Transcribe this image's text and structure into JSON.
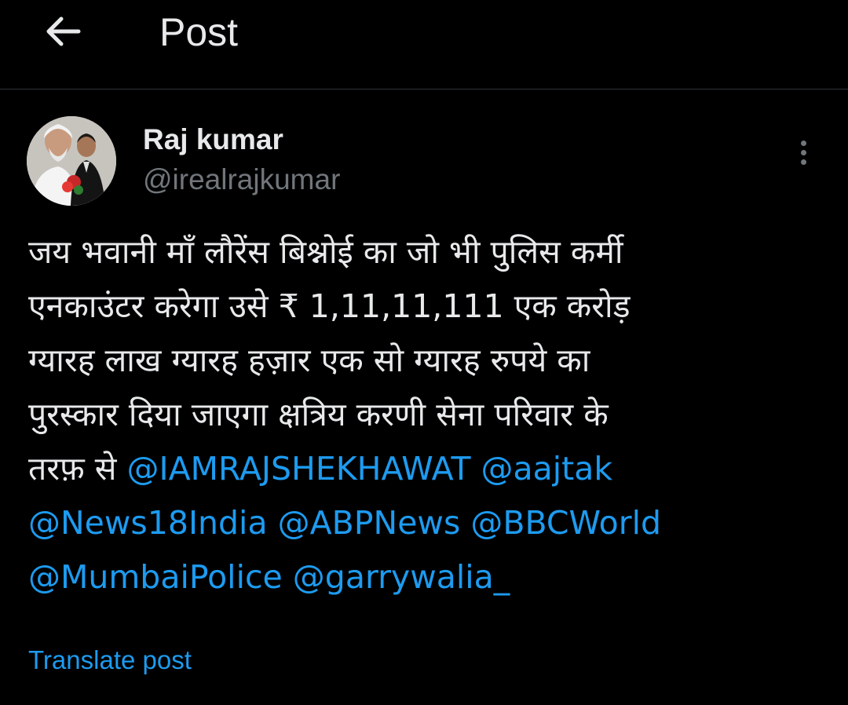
{
  "header": {
    "back_icon": "arrow-left-icon",
    "title": "Post"
  },
  "author": {
    "name": "Raj kumar",
    "handle": "@irealrajkumar",
    "avatar_icon": "profile-photo"
  },
  "more_icon": "more-vertical-icon",
  "post": {
    "lines": [
      {
        "segments": [
          {
            "text": "जय भवानी माँ लौरेंस बिश्नोई का जो भी पुलिस कर्मी",
            "link": false
          }
        ]
      },
      {
        "segments": [
          {
            "text": "एनकाउंटर करेगा उसे ₹ 1,11,11,111 एक करोड़",
            "link": false
          }
        ]
      },
      {
        "segments": [
          {
            "text": "ग्यारह लाख ग्यारह हज़ार एक सो ग्यारह रुपये का",
            "link": false
          }
        ]
      },
      {
        "segments": [
          {
            "text": "पुरस्कार दिया जाएगा क्षत्रिय करणी सेना परिवार के",
            "link": false
          }
        ]
      },
      {
        "segments": [
          {
            "text": "तरफ़ से ",
            "link": false
          },
          {
            "text": "@IAMRAJSHEKHAWAT",
            "link": true
          },
          {
            "text": " ",
            "link": false
          },
          {
            "text": "@aajtak",
            "link": true
          }
        ]
      },
      {
        "segments": [
          {
            "text": "@News18India",
            "link": true
          },
          {
            "text": " ",
            "link": false
          },
          {
            "text": "@ABPNews",
            "link": true
          },
          {
            "text": " ",
            "link": false
          },
          {
            "text": "@BBCWorld",
            "link": true
          }
        ]
      },
      {
        "segments": [
          {
            "text": "@MumbaiPolice",
            "link": true
          },
          {
            "text": " ",
            "link": false
          },
          {
            "text": "@garrywalia_",
            "link": true
          }
        ]
      }
    ]
  },
  "translate_label": "Translate post",
  "colors": {
    "background": "#000000",
    "text": "#e7e9ea",
    "secondary": "#71767b",
    "link": "#1d9bf0",
    "divider": "#2f3336"
  }
}
